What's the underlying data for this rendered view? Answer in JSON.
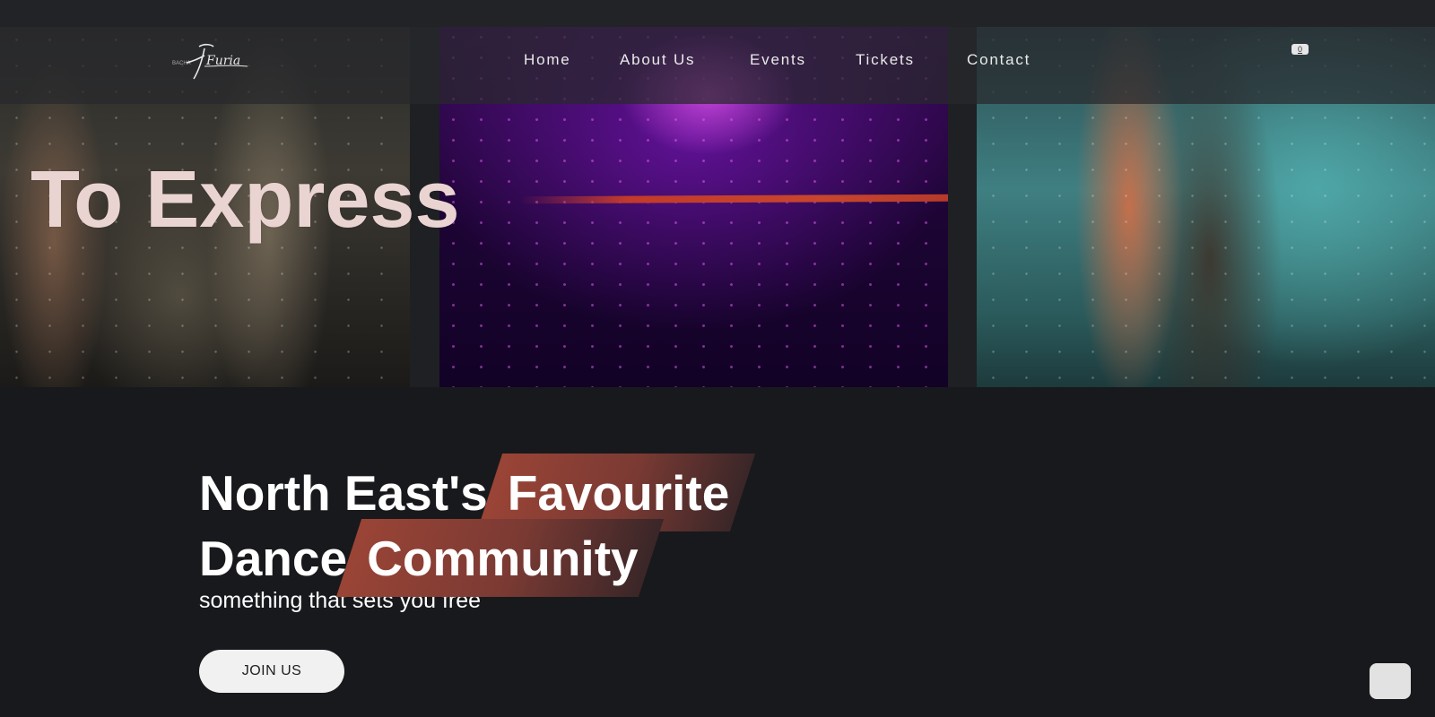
{
  "brand": {
    "logo_small": "BACHA",
    "logo_script": "Furia",
    "logo_icon": "signature-logo"
  },
  "nav": {
    "items": [
      {
        "label": "Home"
      },
      {
        "label": "About Us"
      },
      {
        "label": "Events"
      },
      {
        "label": "Tickets"
      },
      {
        "label": "Contact"
      }
    ],
    "cart_count": "0"
  },
  "hero": {
    "overlay_word": "To Express",
    "headline_line1_plain": "North East's",
    "headline_line1_highlight": "Favourite",
    "headline_line2_plain": "Dance",
    "headline_line2_highlight": "Community",
    "tagline": "something that sets you free",
    "cta_label": "JOIN US"
  },
  "colors": {
    "background": "#18191c",
    "highlight": "#9a4436",
    "button_bg": "#f1f1f1"
  }
}
